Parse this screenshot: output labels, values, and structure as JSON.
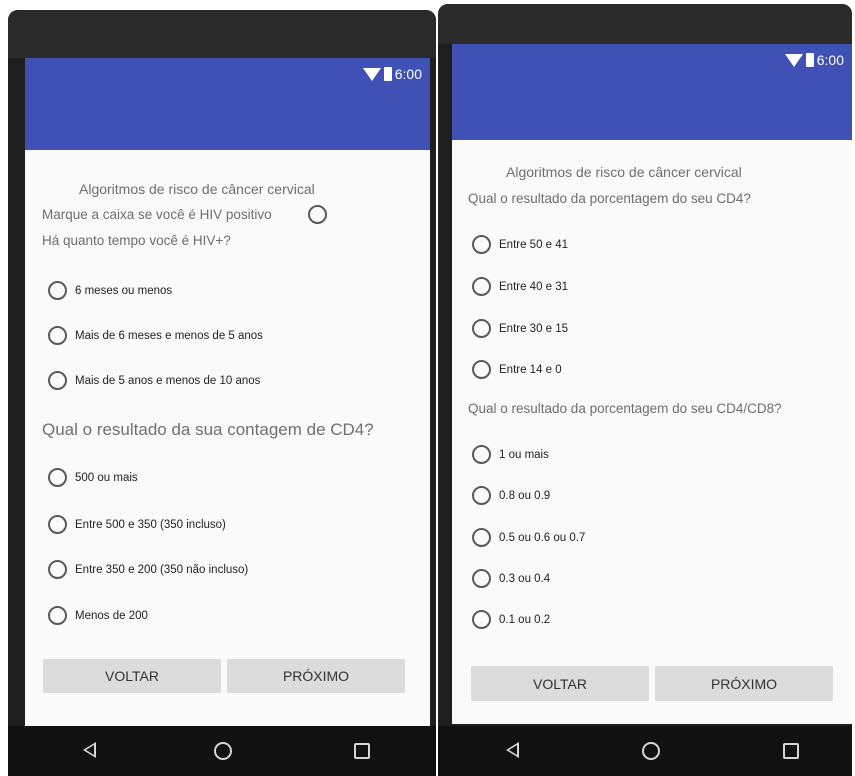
{
  "status_time": "6:00",
  "screen1": {
    "title": "Algoritmos de risco de câncer cervical",
    "hiv_checkbox_label": "Marque a caixa se você é HIV positivo",
    "q_time": "Há quanto tempo você é HIV+?",
    "time_options": [
      "6 meses ou menos",
      "Mais de 6 meses e menos de 5 anos",
      "Mais de 5 anos e menos de 10 anos"
    ],
    "q_cd4_count": "Qual o resultado da sua contagem de CD4?",
    "cd4_count_options": [
      "500 ou mais",
      "Entre 500 e 350 (350 incluso)",
      "Entre 350 e 200 (350 não incluso)",
      "Menos de 200"
    ],
    "back_label": "VOLTAR",
    "next_label": "PRÓXIMO"
  },
  "screen2": {
    "title": "Algoritmos de risco de câncer cervical",
    "q_cd4_percent": "Qual o resultado da porcentagem do seu CD4?",
    "cd4_percent_options": [
      "Entre 50 e 41",
      "Entre 40 e 31",
      "Entre 30 e 15",
      "Entre 14 e 0"
    ],
    "q_ratio": "Qual o resultado da porcentagem do seu CD4/CD8?",
    "ratio_options": [
      "1 ou mais",
      "0.8 ou 0.9",
      "0.5 ou 0.6 ou 0.7",
      "0.3 ou 0.4",
      "0.1 ou 0.2"
    ],
    "back_label": "VOLTAR",
    "next_label": "PRÓXIMO"
  }
}
